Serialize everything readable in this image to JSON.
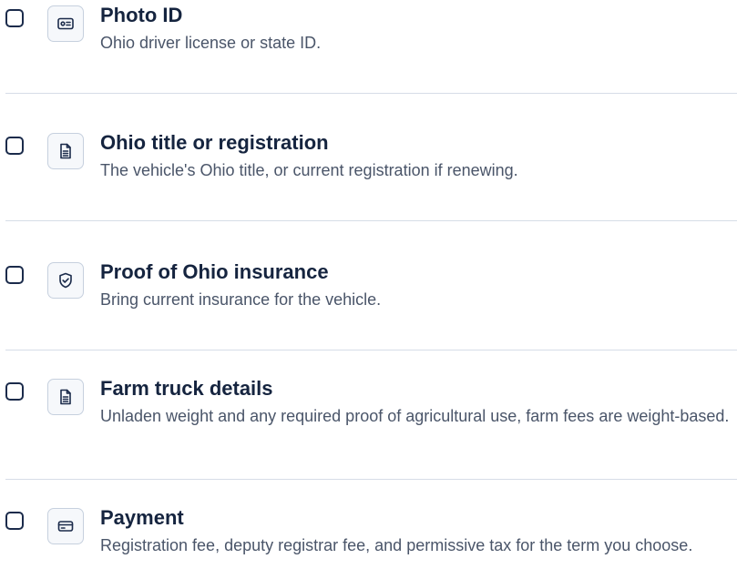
{
  "checklist": {
    "items": [
      {
        "title": "Photo ID",
        "description": "Ohio driver license or state ID.",
        "icon": "id-card-icon",
        "checked": false
      },
      {
        "title": "Ohio title or registration",
        "description": "The vehicle's Ohio title, or current registration if renewing.",
        "icon": "document-icon",
        "checked": false
      },
      {
        "title": "Proof of Ohio insurance",
        "description": "Bring current insurance for the vehicle.",
        "icon": "shield-check-icon",
        "checked": false
      },
      {
        "title": "Farm truck details",
        "description": "Unladen weight and any required proof of agricultural use, farm fees are weight-based.",
        "icon": "document-icon",
        "checked": false
      },
      {
        "title": "Payment",
        "description": "Registration fee, deputy registrar fee, and permissive tax for the term you choose.",
        "icon": "credit-card-icon",
        "checked": false
      }
    ]
  },
  "colors": {
    "text_primary": "#15243f",
    "text_secondary": "#4a5569",
    "border": "#c6d0de",
    "divider": "#d6dde7",
    "icon_stroke": "#1b2b4b"
  }
}
